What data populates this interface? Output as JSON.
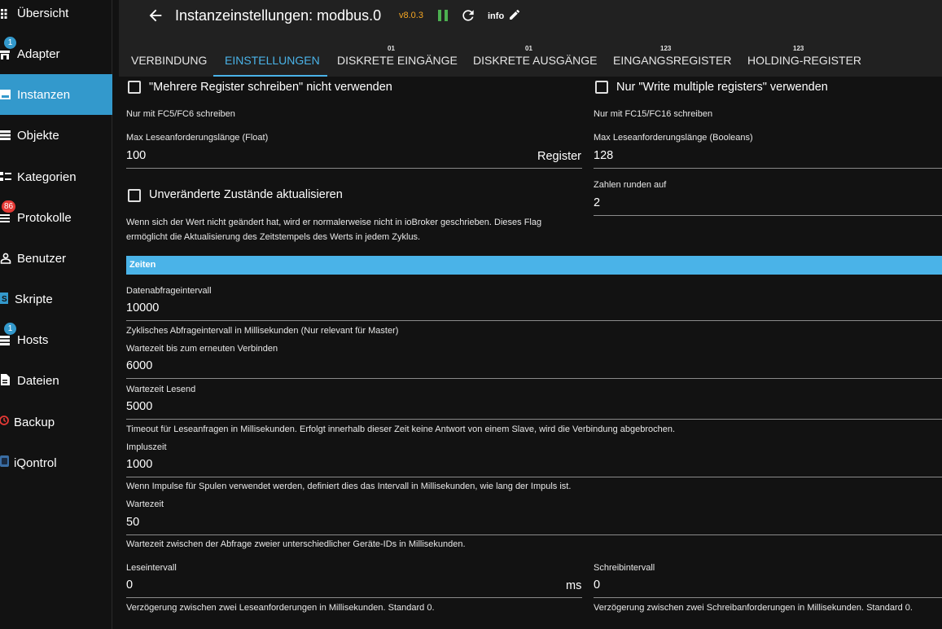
{
  "sidebar": {
    "items": [
      {
        "label": "Übersicht",
        "icon": "grid-icon"
      },
      {
        "label": "Adapter",
        "icon": "store-icon",
        "badge": "1"
      },
      {
        "label": "Instanzen",
        "icon": "instances-icon",
        "active": true
      },
      {
        "label": "Objekte",
        "icon": "list-icon"
      },
      {
        "label": "Kategorien",
        "icon": "categories-icon"
      },
      {
        "label": "Protokolle",
        "icon": "log-icon",
        "badge": "86"
      },
      {
        "label": "Benutzer",
        "icon": "user-icon"
      },
      {
        "label": "Skripte",
        "icon": "script-icon"
      },
      {
        "label": "Hosts",
        "icon": "hosts-icon",
        "badge": "1"
      },
      {
        "label": "Dateien",
        "icon": "file-icon"
      },
      {
        "label": "Backup",
        "icon": "backup-icon"
      },
      {
        "label": "iQontrol",
        "icon": "iqontrol-icon"
      }
    ]
  },
  "header": {
    "title": "Instanzeinstellungen: modbus.0",
    "version": "v8.0.3",
    "info": "info",
    "tabs": [
      {
        "label": "VERBINDUNG",
        "sup": ""
      },
      {
        "label": "EINSTELLUNGEN",
        "sup": "",
        "active": true
      },
      {
        "label": "DISKRETE EINGÄNGE",
        "sup": "01"
      },
      {
        "label": "DISKRETE AUSGÄNGE",
        "sup": "01"
      },
      {
        "label": "EINGANGSREGISTER",
        "sup": "123"
      },
      {
        "label": "HOLDING-REGISTER",
        "sup": "123"
      }
    ]
  },
  "settings": {
    "no_multi_write_label": "\"Mehrere Register schreiben\" nicht verwenden",
    "no_multi_write_help": "Nur mit FC5/FC6 schreiben",
    "only_multi_write_label": "Nur \"Write multiple registers\" verwenden",
    "only_multi_write_help": "Nur mit FC15/FC16 schreiben",
    "max_read_float_label": "Max Leseanforderungslänge (Float)",
    "max_read_float_value": "100",
    "max_read_float_unit": "Register",
    "max_read_bool_label": "Max Leseanforderungslänge (Booleans)",
    "max_read_bool_value": "128",
    "update_unchanged_label": "Unveränderte Zustände aktualisieren",
    "update_unchanged_help": "Wenn sich der Wert nicht geändert hat, wird er normalerweise nicht in ioBroker geschrieben. Dieses Flag ermöglicht die Aktualisierung des Zeitstempels des Werts in jedem Zyklus.",
    "round_label": "Zahlen runden auf",
    "round_value": "2"
  },
  "times": {
    "section_title": "Zeiten",
    "poll_label": "Datenabfrageintervall",
    "poll_value": "10000",
    "poll_help": "Zyklisches Abfrageintervall in Millisekunden (Nur relevant für Master)",
    "reconnect_label": "Wartezeit bis zum erneuten Verbinden",
    "reconnect_value": "6000",
    "read_timeout_label": "Wartezeit Lesend",
    "read_timeout_value": "5000",
    "read_timeout_help": "Timeout für Leseanfragen in Millisekunden. Erfolgt innerhalb dieser Zeit keine Antwort von einem Slave, wird die Verbindung abgebrochen.",
    "pulse_label": "Impluszeit",
    "pulse_value": "1000",
    "pulse_help": "Wenn Impulse für Spulen verwendet werden, definiert dies das Intervall in Millisekunden, wie lang der Impuls ist.",
    "wait_label": "Wartezeit",
    "wait_value": "50",
    "wait_help": "Wartezeit zwischen der Abfrage zweier unterschiedlicher Geräte-IDs in Millisekunden.",
    "read_interval_label": "Leseintervall",
    "read_interval_value": "0",
    "read_interval_unit": "ms",
    "read_interval_help": "Verzögerung zwischen zwei Leseanforderungen in Millisekunden. Standard 0.",
    "write_interval_label": "Schreibintervall",
    "write_interval_value": "0",
    "write_interval_help": "Verzögerung zwischen zwei Schreibanforderungen in Millisekunden. Standard 0."
  },
  "colors": {
    "accent": "#4ab3e8",
    "active_nav": "#3399cc",
    "version": "#f5a623",
    "pause": "#4caf50",
    "badge_red": "#e53935"
  }
}
